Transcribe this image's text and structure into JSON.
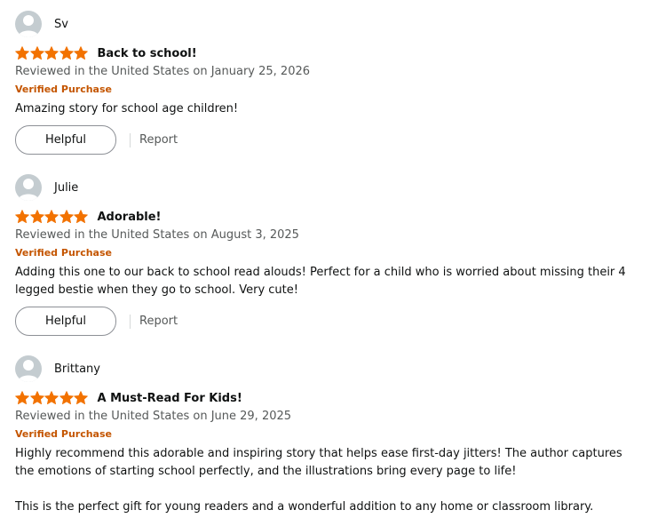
{
  "colors": {
    "star": "#f27200",
    "verified": "#c45500",
    "date": "#565959",
    "avatar": "#c4ccd0"
  },
  "reviews": [
    {
      "name": "Sv",
      "rating": 5,
      "title": "Back to school!",
      "date": "Reviewed in the United States on January 25, 2026",
      "verified": "Verified Purchase",
      "body": [
        "Amazing story for school age children!"
      ],
      "helpful_label": "Helpful",
      "report_label": "Report"
    },
    {
      "name": "Julie",
      "rating": 5,
      "title": "Adorable!",
      "date": "Reviewed in the United States on August 3, 2025",
      "verified": "Verified Purchase",
      "body": [
        "Adding this one to our back to school read alouds! Perfect for a child who is worried about missing their 4 legged bestie when they go to school. Very cute!"
      ],
      "helpful_label": "Helpful",
      "report_label": "Report"
    },
    {
      "name": "Brittany",
      "rating": 5,
      "title": "A Must-Read For Kids!",
      "date": "Reviewed in the United States on June 29, 2025",
      "verified": "Verified Purchase",
      "body": [
        "Highly recommend this adorable and inspiring story that helps ease first-day jitters! The author captures the emotions of starting school perfectly, and the illustrations bring every page to life!",
        "This is the perfect gift for young readers and a wonderful addition to any home or classroom library."
      ]
    }
  ]
}
